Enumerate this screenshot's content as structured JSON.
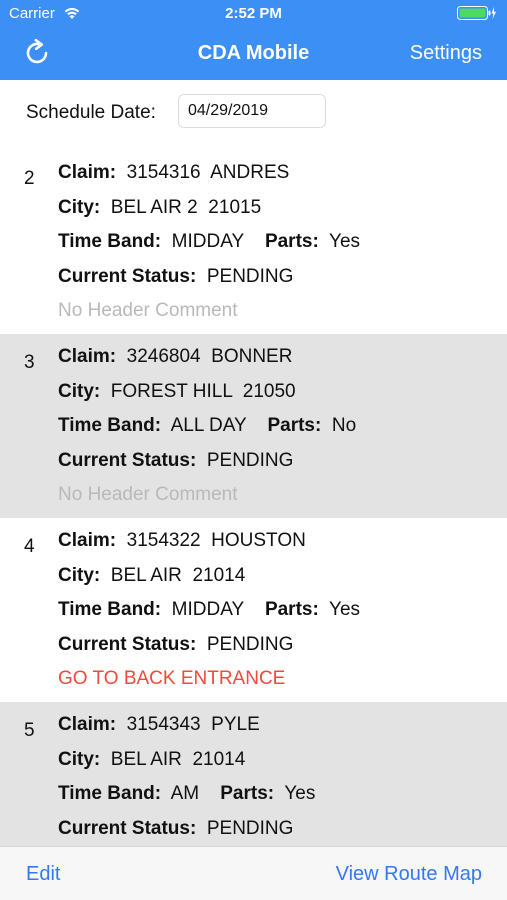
{
  "status_bar": {
    "carrier": "Carrier",
    "time": "2:52 PM"
  },
  "nav": {
    "title": "CDA Mobile",
    "settings_label": "Settings",
    "refresh_icon": "refresh-icon"
  },
  "schedule": {
    "label": "Schedule Date:",
    "date": "04/29/2019"
  },
  "labels": {
    "claim": "Claim:",
    "city": "City:",
    "time_band": "Time Band:",
    "parts": "Parts:",
    "current_status": "Current Status:"
  },
  "rows": [
    {
      "num": "2",
      "claim": "3154316  ANDRES",
      "city": "BEL AIR 2  21015",
      "time_band": "MIDDAY",
      "parts": "Yes",
      "status": "PENDING",
      "comment": "No Header Comment",
      "comment_type": "none"
    },
    {
      "num": "3",
      "claim": "3246804  BONNER",
      "city": "FOREST HILL  21050",
      "time_band": "ALL DAY",
      "parts": "No",
      "status": "PENDING",
      "comment": "No Header Comment",
      "comment_type": "none"
    },
    {
      "num": "4",
      "claim": "3154322  HOUSTON",
      "city": "BEL AIR  21014",
      "time_band": "MIDDAY",
      "parts": "Yes",
      "status": "PENDING",
      "comment": "GO TO BACK ENTRANCE",
      "comment_type": "alert"
    },
    {
      "num": "5",
      "claim": "3154343  PYLE",
      "city": "BEL AIR  21014",
      "time_band": "AM",
      "parts": "Yes",
      "status": "PENDING",
      "comment": "",
      "comment_type": "none"
    }
  ],
  "toolbar": {
    "edit_label": "Edit",
    "map_label": "View Route Map"
  },
  "colors": {
    "accent": "#3b8ff5",
    "link": "#3478f6",
    "alert": "#f14a3c",
    "muted": "#b9b9b9",
    "alt_row": "#e3e3e3"
  }
}
